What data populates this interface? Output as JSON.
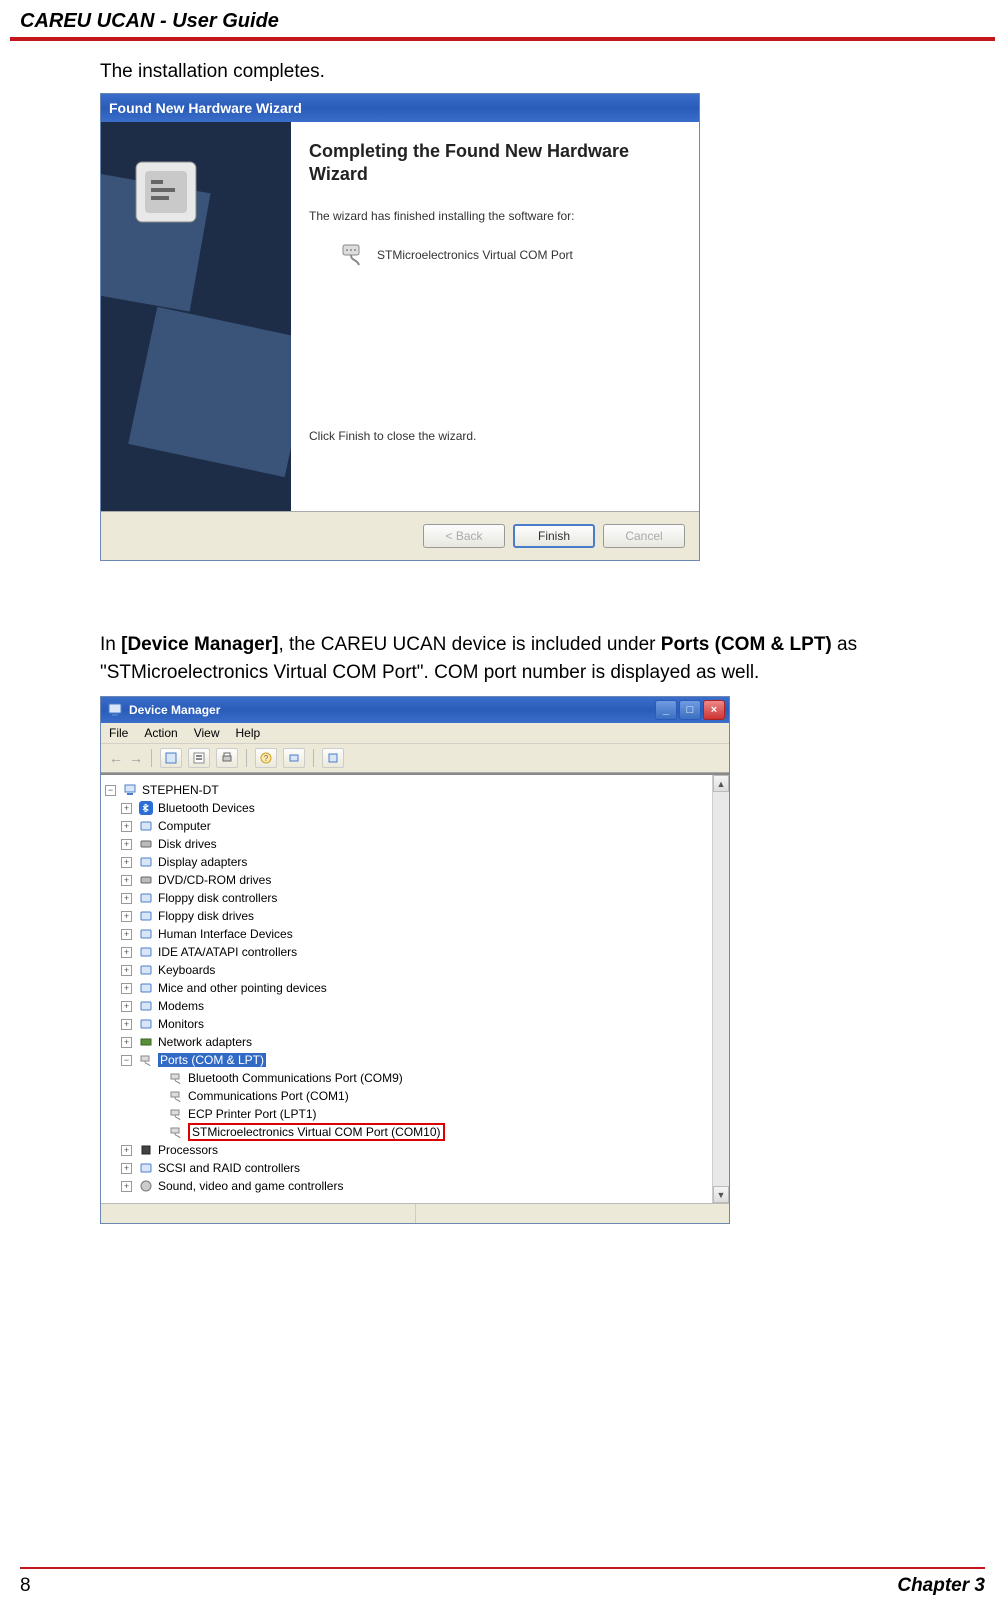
{
  "header": {
    "title": "CAREU UCAN -  User Guide"
  },
  "paragraphs": {
    "p1": "The installation completes.",
    "p2_pre": "In ",
    "p2_b1": "[Device Manager]",
    "p2_mid": ", the CAREU UCAN device is included under ",
    "p2_b2": "Ports (COM & LPT)",
    "p2_post": " as \"STMicroelectronics Virtual COM Port\". COM port number is displayed as well."
  },
  "wizard": {
    "title": "Found New Hardware Wizard",
    "heading": "Completing the Found New Hardware Wizard",
    "subtext": "The wizard has finished installing the software for:",
    "device": "STMicroelectronics Virtual COM Port",
    "footnote": "Click Finish to close the wizard.",
    "buttons": {
      "back": "< Back",
      "finish": "Finish",
      "cancel": "Cancel"
    }
  },
  "devmgr": {
    "title": "Device Manager",
    "menu": [
      "File",
      "Action",
      "View",
      "Help"
    ],
    "root": "STEPHEN-DT",
    "nodes_closed": [
      "Bluetooth Devices",
      "Computer",
      "Disk drives",
      "Display adapters",
      "DVD/CD-ROM drives",
      "Floppy disk controllers",
      "Floppy disk drives",
      "Human Interface Devices",
      "IDE ATA/ATAPI controllers",
      "Keyboards",
      "Mice and other pointing devices",
      "Modems",
      "Monitors",
      "Network adapters"
    ],
    "ports_label": "Ports (COM & LPT)",
    "ports_children": [
      "Bluetooth Communications Port (COM9)",
      "Communications Port (COM1)",
      "ECP Printer Port (LPT1)",
      "STMicroelectronics Virtual COM Port (COM10)"
    ],
    "nodes_after": [
      "Processors",
      "SCSI and RAID controllers",
      "Sound, video and game controllers"
    ]
  },
  "footer": {
    "page": "8",
    "chapter": "Chapter 3"
  }
}
